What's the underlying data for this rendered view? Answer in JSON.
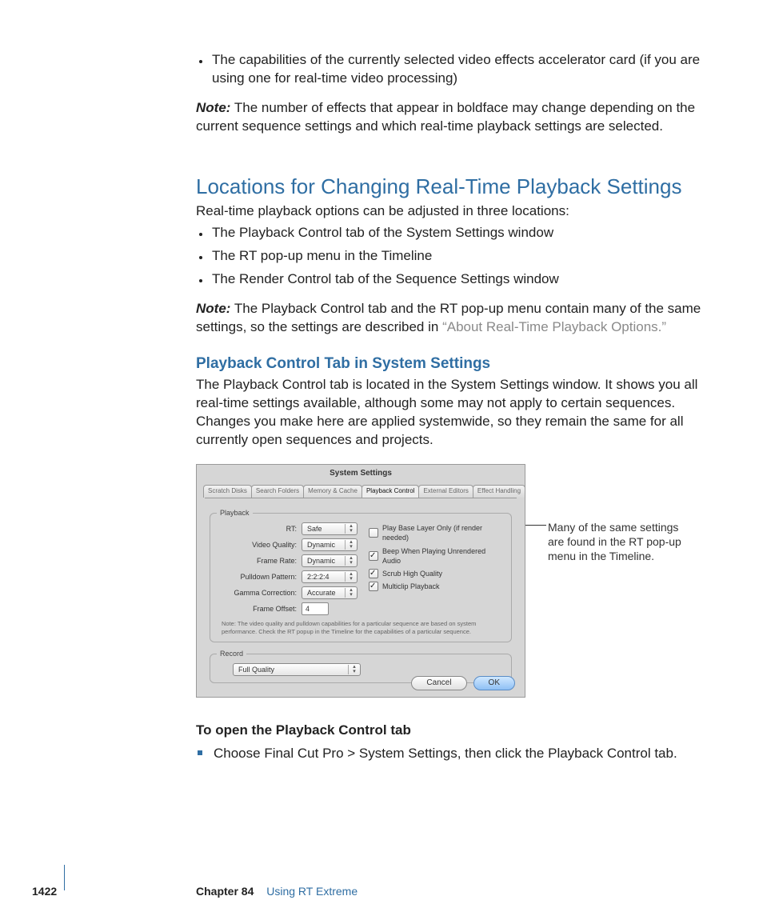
{
  "intro": {
    "bullet1": "The capabilities of the currently selected video effects accelerator card (if you are using one for real-time video processing)",
    "note_label": "Note:",
    "note_text": "The number of effects that appear in boldface may change depending on the current sequence settings and which real-time playback settings are selected."
  },
  "section": {
    "heading": "Locations for Changing Real-Time Playback Settings",
    "lead": "Real-time playback options can be adjusted in three locations:",
    "items": [
      "The Playback Control tab of the System Settings window",
      "The RT pop-up menu in the Timeline",
      "The Render Control tab of the Sequence Settings window"
    ],
    "note_label": "Note:",
    "note_text_a": "The Playback Control tab and the RT pop-up menu contain many of the same settings, so the settings are described in ",
    "note_link": "“About Real-Time Playback Options.”"
  },
  "subsection": {
    "heading": "Playback Control Tab in System Settings",
    "body": "The Playback Control tab is located in the System Settings window. It shows you all real-time settings available, although some may not apply to certain sequences. Changes you make here are applied systemwide, so they remain the same for all currently open sequences and projects."
  },
  "figure": {
    "title": "System Settings",
    "tabs": [
      "Scratch Disks",
      "Search Folders",
      "Memory & Cache",
      "Playback Control",
      "External Editors",
      "Effect Handling"
    ],
    "playback_legend": "Playback",
    "record_legend": "Record",
    "fields": {
      "rt_label": "RT:",
      "rt_value": "Safe",
      "vq_label": "Video Quality:",
      "vq_value": "Dynamic",
      "fr_label": "Frame Rate:",
      "fr_value": "Dynamic",
      "pp_label": "Pulldown Pattern:",
      "pp_value": "2:2:2:4",
      "gc_label": "Gamma Correction:",
      "gc_value": "Accurate",
      "fo_label": "Frame Offset:",
      "fo_value": "4"
    },
    "checks": {
      "c1": "Play Base Layer Only (if render needed)",
      "c2": "Beep When Playing Unrendered Audio",
      "c3": "Scrub High Quality",
      "c4": "Multiclip Playback"
    },
    "note": "Note: The video quality and pulldown capabilities for a particular sequence are based on system performance. Check the RT popup in the Timeline for the capabilities of a particular sequence.",
    "record_value": "Full Quality",
    "btn_cancel": "Cancel",
    "btn_ok": "OK",
    "callout": "Many of the same settings are found in the RT pop-up menu in the Timeline."
  },
  "howto": {
    "heading": "To open the Playback Control tab",
    "step": "Choose Final Cut Pro > System Settings, then click the Playback Control tab."
  },
  "footer": {
    "page": "1422",
    "chapter_label": "Chapter 84",
    "chapter_title": "Using RT Extreme"
  }
}
